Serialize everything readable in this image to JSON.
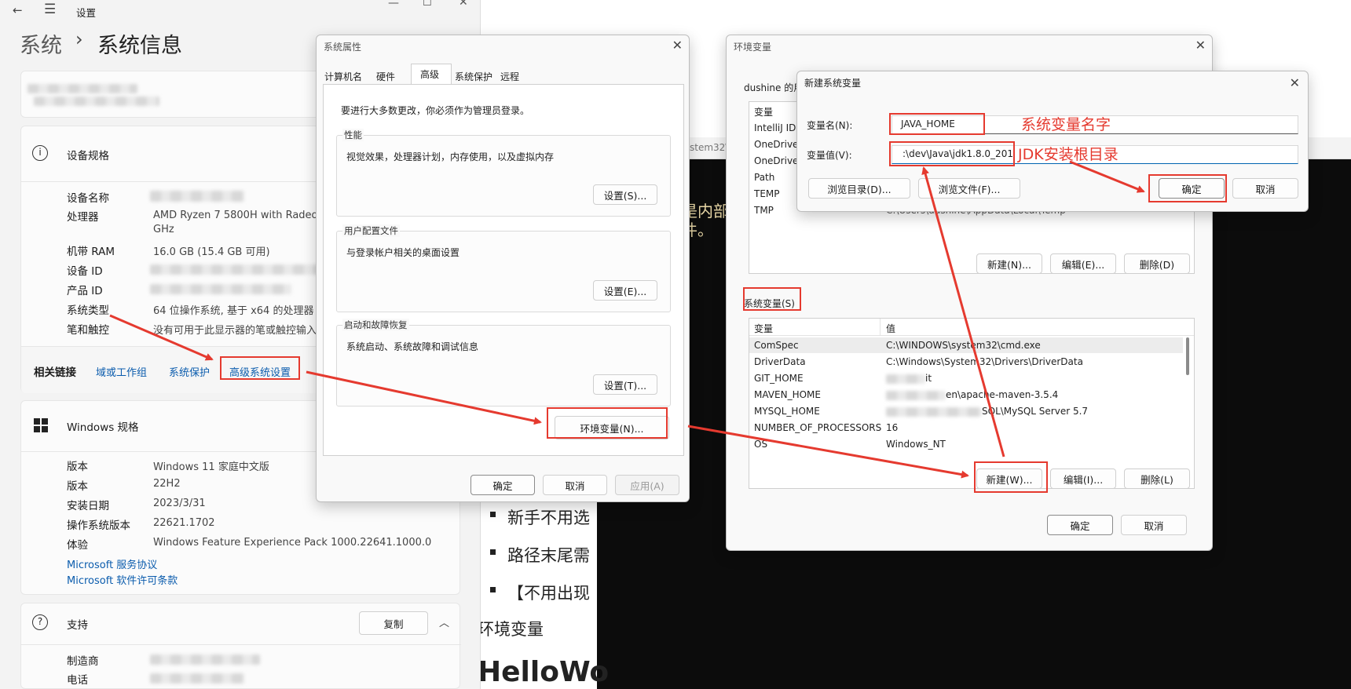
{
  "settings": {
    "titlebar": "设置",
    "breadcrumb_root": "系统",
    "breadcrumb_sep": "›",
    "breadcrumb_current": "系统信息",
    "device_spec_title": "设备规格",
    "device_specs": [
      {
        "label": "设备名称",
        "value": ""
      },
      {
        "label": "处理器",
        "value": "AMD Ryzen 7 5800H with Radeon",
        "value2": "GHz"
      },
      {
        "label": "机带 RAM",
        "value": "16.0 GB (15.4 GB 可用)"
      },
      {
        "label": "设备 ID",
        "value": ""
      },
      {
        "label": "产品 ID",
        "value": ""
      },
      {
        "label": "系统类型",
        "value": "64 位操作系统, 基于 x64 的处理器"
      },
      {
        "label": "笔和触控",
        "value": "没有可用于此显示器的笔或触控输入"
      }
    ],
    "related_links_label": "相关链接",
    "related_links": [
      "域或工作组",
      "系统保护",
      "高级系统设置"
    ],
    "windows_spec_title": "Windows 规格",
    "windows_specs": [
      {
        "label": "版本",
        "value": "Windows 11 家庭中文版"
      },
      {
        "label": "版本",
        "value": "22H2"
      },
      {
        "label": "安装日期",
        "value": "2023/3/31"
      },
      {
        "label": "操作系统版本",
        "value": "22621.1702"
      },
      {
        "label": "体验",
        "value": "Windows Feature Experience Pack 1000.22641.1000.0"
      }
    ],
    "windows_links": [
      "Microsoft 服务协议",
      "Microsoft 软件许可条款"
    ],
    "support_title": "支持",
    "copy_button": "复制",
    "support_rows": [
      "制造商",
      "电话"
    ]
  },
  "sysprops": {
    "title": "系统属性",
    "tabs": [
      "计算机名",
      "硬件",
      "高级",
      "系统保护",
      "远程"
    ],
    "active_tab": "高级",
    "admin_note": "要进行大多数更改，你必须作为管理员登录。",
    "perf_label": "性能",
    "perf_desc": "视觉效果，处理器计划，内存使用，以及虚拟内存",
    "profile_label": "用户配置文件",
    "profile_desc": "与登录帐户相关的桌面设置",
    "startup_label": "启动和故障恢复",
    "startup_desc": "系统启动、系统故障和调试信息",
    "perf_button": "设置(S)...",
    "profile_button": "设置(E)...",
    "startup_button": "设置(T)...",
    "env_button": "环境变量(N)...",
    "ok": "确定",
    "cancel": "取消",
    "apply": "应用(A)"
  },
  "envvars": {
    "title": "环境变量",
    "user_group_label": "dushine 的用",
    "col_var": "变量",
    "col_val": "值",
    "user_vars": [
      "IntelliJ IDE",
      "OneDrive",
      "OneDrive",
      "Path",
      "TEMP",
      "TMP"
    ],
    "user_tmp_value": "C:\\Users\\dushine\\AppData\\Local\\Temp",
    "user_new": "新建(N)...",
    "user_edit": "编辑(E)...",
    "user_delete": "删除(D)",
    "system_label": "系统变量(S)",
    "system_vars": [
      {
        "name": "ComSpec",
        "value": "C:\\WINDOWS\\system32\\cmd.exe"
      },
      {
        "name": "DriverData",
        "value": "C:\\Windows\\System32\\Drivers\\DriverData"
      },
      {
        "name": "GIT_HOME",
        "value": "it"
      },
      {
        "name": "MAVEN_HOME",
        "value": "en\\apache-maven-3.5.4"
      },
      {
        "name": "MYSQL_HOME",
        "value": "SQL\\MySQL Server 5.7"
      },
      {
        "name": "NUMBER_OF_PROCESSORS",
        "value": "16"
      },
      {
        "name": "OS",
        "value": "Windows_NT"
      }
    ],
    "sys_new": "新建(W)...",
    "sys_edit": "编辑(I)...",
    "sys_delete": "删除(L)",
    "ok": "确定",
    "cancel": "取消"
  },
  "newvar": {
    "title": "新建系统变量",
    "name_label": "变量名(N):",
    "name_value": "JAVA_HOME",
    "value_label": "变量值(V):",
    "value_value": ":\\dev\\Java\\jdk1.8.0_201",
    "browse_dir": "浏览目录(D)...",
    "browse_file": "浏览文件(F)...",
    "ok": "确定",
    "cancel": "取消"
  },
  "annotations": {
    "name_note": "系统变量名字",
    "value_note": "JDK安装根目录"
  },
  "background": {
    "console_path": "stem32\\",
    "console_text1": "是内部",
    "console_text2": "件。",
    "doc_bullets": [
      "新手不用选",
      "路径末尾需",
      "【不用出现"
    ],
    "doc_heading": "环境变量",
    "doc_big": "HelloWo"
  },
  "colors": {
    "annotation": "#e53a2f",
    "link": "#0b5cad",
    "console_bg": "#0c0c0c",
    "console_text": "#e8d7a6"
  }
}
